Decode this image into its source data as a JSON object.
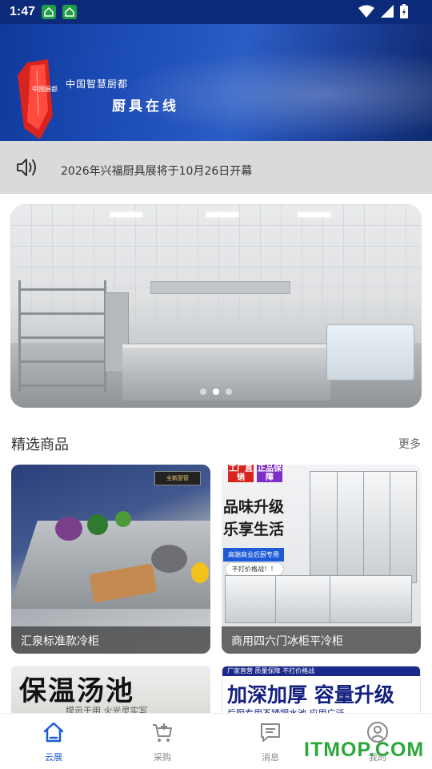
{
  "status_bar": {
    "time": "1:47",
    "left_icons": [
      "app-notification-icon",
      "app-notification-icon"
    ],
    "right_icons": [
      "wifi-icon",
      "signal-icon",
      "battery-icon"
    ]
  },
  "header": {
    "logo_text": "中国厨都",
    "subtitle": "中国智慧厨都",
    "title": "厨具在线"
  },
  "notice": {
    "icon": "speaker-icon",
    "text": "2026年兴福厨具展将于10月26日开幕"
  },
  "carousel": {
    "total_slides": 3,
    "active_index": 1
  },
  "featured": {
    "title": "精选商品",
    "more_label": "更多",
    "items": [
      {
        "caption": "汇泉标准款冷柜",
        "brand_tag": "全新厨管"
      },
      {
        "caption": "商用四六门冰柜平冷柜",
        "badge1": "工厂直销",
        "badge2": "正品保障",
        "promo_line1": "品味升级",
        "promo_line2": "乐享生活",
        "promo_sub": "高端商业后厨专用",
        "promo_pill": "不打价格战！！"
      }
    ],
    "partial_items": [
      {
        "headline": "保温汤池",
        "sub": "提示于用 火光灵实写"
      },
      {
        "top_strip": "厂家直营 质量保障 不打价格战",
        "headline": "加深加厚 容量升级",
        "sub": "后厨专用不锈钢水池 应用广泛"
      }
    ]
  },
  "bottom_nav": {
    "items": [
      {
        "label": "云展",
        "icon": "home-icon",
        "active": true
      },
      {
        "label": "采购",
        "icon": "cart-icon",
        "active": false
      },
      {
        "label": "消息",
        "icon": "message-icon",
        "active": false
      },
      {
        "label": "我的",
        "icon": "user-icon",
        "active": false
      }
    ]
  },
  "watermark": "ITMOP.COM",
  "colors": {
    "accent": "#1d5bd6",
    "status_bar_bg": "#0b2a7a",
    "notice_bg": "#dadada",
    "watermark": "#2aa83a"
  }
}
